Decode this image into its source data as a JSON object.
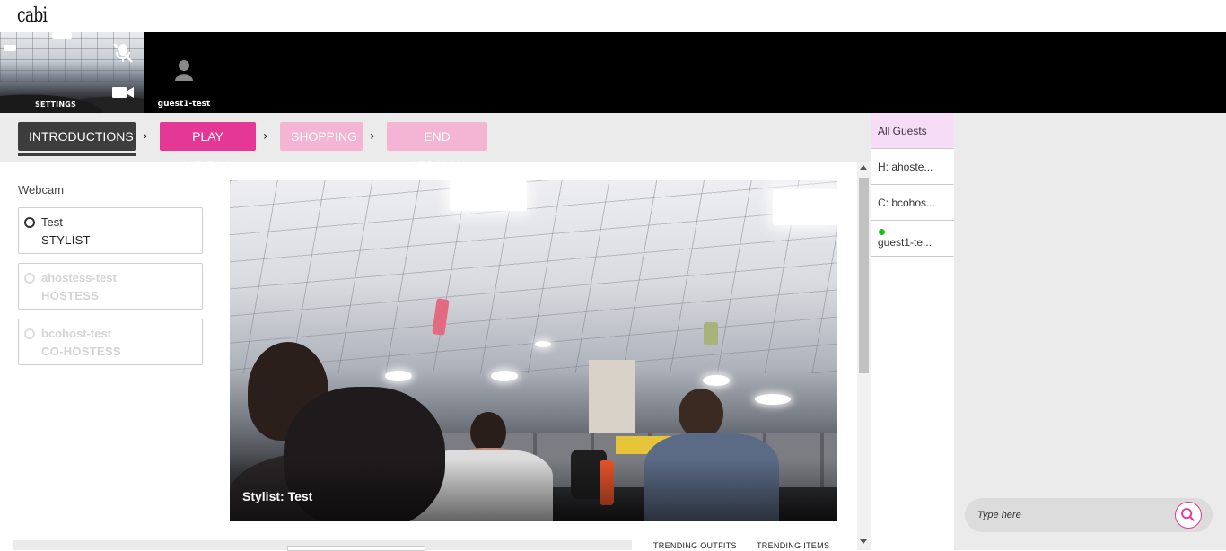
{
  "brand": {
    "logo_text": "cabi"
  },
  "video_strip": {
    "self_label": "SETTINGS",
    "guest_name": "guest1-test"
  },
  "steps": [
    {
      "label": "INTRODUCTIONS",
      "state": "active"
    },
    {
      "label": "PLAY VIDEOS",
      "state": "enabled"
    },
    {
      "label": "SHOPPING",
      "state": "disabled"
    },
    {
      "label": "END SESSION",
      "state": "disabled"
    }
  ],
  "webcam": {
    "title": "Webcam",
    "options": [
      {
        "name": "Test",
        "role": "STYLIST",
        "selected": true,
        "disabled": false
      },
      {
        "name": "ahostess-test",
        "role": "HOSTESS",
        "selected": false,
        "disabled": true
      },
      {
        "name": "bcohost-test",
        "role": "CO-HOSTESS",
        "selected": false,
        "disabled": true
      }
    ]
  },
  "main_video": {
    "caption": "Stylist: Test"
  },
  "trending": {
    "outfits": "TRENDING OUTFITS",
    "items": "TRENDING ITEMS"
  },
  "guests": {
    "tabs": [
      {
        "label": "All Guests",
        "active": true
      },
      {
        "label": "H: ahoste...",
        "active": false
      },
      {
        "label": "C: bcohos...",
        "active": false
      },
      {
        "label": "guest1-te...",
        "active": false,
        "online": true
      }
    ]
  },
  "chat": {
    "placeholder": "Type here"
  },
  "colors": {
    "accent": "#e53795",
    "accent_light": "#f3b5d3",
    "active_tab": "#f7dcf8",
    "online": "#16c416"
  }
}
